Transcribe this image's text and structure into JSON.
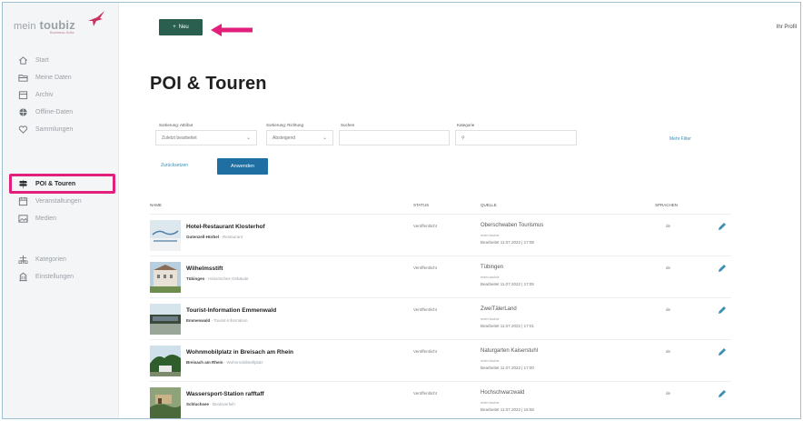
{
  "app": {
    "logo_main": "toubiz",
    "logo_prefix": "mein",
    "logo_sub": "Business-Suite"
  },
  "sidebar": {
    "items": [
      {
        "label": "Start",
        "icon": "home-icon"
      },
      {
        "label": "Meine Daten",
        "icon": "folder-icon"
      },
      {
        "label": "Archiv",
        "icon": "archive-icon"
      },
      {
        "label": "Offline-Daten",
        "icon": "globe-icon"
      },
      {
        "label": "Sammlungen",
        "icon": "heart-icon"
      },
      {
        "label": "POI & Touren",
        "icon": "signpost-icon",
        "active": true
      },
      {
        "label": "Veranstaltungen",
        "icon": "calendar-icon"
      },
      {
        "label": "Medien",
        "icon": "image-icon"
      },
      {
        "label": "Kategorien",
        "icon": "tags-icon"
      },
      {
        "label": "Einstellungen",
        "icon": "building-icon"
      }
    ]
  },
  "topbar": {
    "new_label": "Neu",
    "user": "Ihr Profil"
  },
  "main": {
    "title": "POI & Touren",
    "filters": {
      "sort_attr_label": "Sortierung: Attribut",
      "sort_attr_value": "Zuletzt bearbeitet",
      "sort_dir_label": "Sortierung: Richtung",
      "sort_dir_value": "Absteigend",
      "search_label": "Suchen",
      "search_value": "",
      "category_label": "Kategorie",
      "category_value": "",
      "more_filters": "Mehr Filter",
      "reset": "Zurücksetzen",
      "apply": "Anwenden"
    },
    "columns": {
      "name": "NAME",
      "status": "STATUS",
      "source": "QUELLE",
      "languages": "SPRACHEN"
    },
    "rows": [
      {
        "name": "Hotel-Restaurant Klosterhof",
        "place": "Gutenzell-Hürbel",
        "category": "Restaurant",
        "status": "Veröffentlicht",
        "source": "Oberschwaben Tourismus",
        "source_sub": "mein.toubiz",
        "edited": "Bearbeitet 11.07.2022 | 17:08",
        "langs": "de"
      },
      {
        "name": "Wilhelmsstift",
        "place": "Tübingen",
        "category": "Historisches Gebäude",
        "status": "Veröffentlicht",
        "source": "Tübingen",
        "source_sub": "mein.toubiz",
        "edited": "Bearbeitet 11.07.2022 | 17:05",
        "langs": "de"
      },
      {
        "name": "Tourist-Information Emmenwald",
        "place": "Emmenwald",
        "category": "Tourist-Information",
        "status": "Veröffentlicht",
        "source": "ZweiTälerLand",
        "source_sub": "mein.toubiz",
        "edited": "Bearbeitet 11.07.2022 | 17:01",
        "langs": "de"
      },
      {
        "name": "Wohnmobilplatz in Breisach am Rhein",
        "place": "Breisach am Rhein",
        "category": "Wohnmobilstellplatz",
        "status": "Veröffentlicht",
        "source": "Naturgarten Kaiserstuhl",
        "source_sub": "mein.toubiz",
        "edited": "Bearbeitet 11.07.2022 | 17:00",
        "langs": "de"
      },
      {
        "name": "Wassersport-Station rafftaff",
        "place": "Schluchsee",
        "category": "Bootsverleih",
        "status": "Veröffentlicht",
        "source": "Hochschwarzwald",
        "source_sub": "mein.toubiz",
        "edited": "Bearbeitet 11.07.2022 | 16:58",
        "langs": "de"
      }
    ]
  },
  "colors": {
    "highlight": "#e2207c",
    "new_button": "#2a5f4f",
    "apply_button": "#1f6fa3",
    "link": "#3a8fb7"
  }
}
